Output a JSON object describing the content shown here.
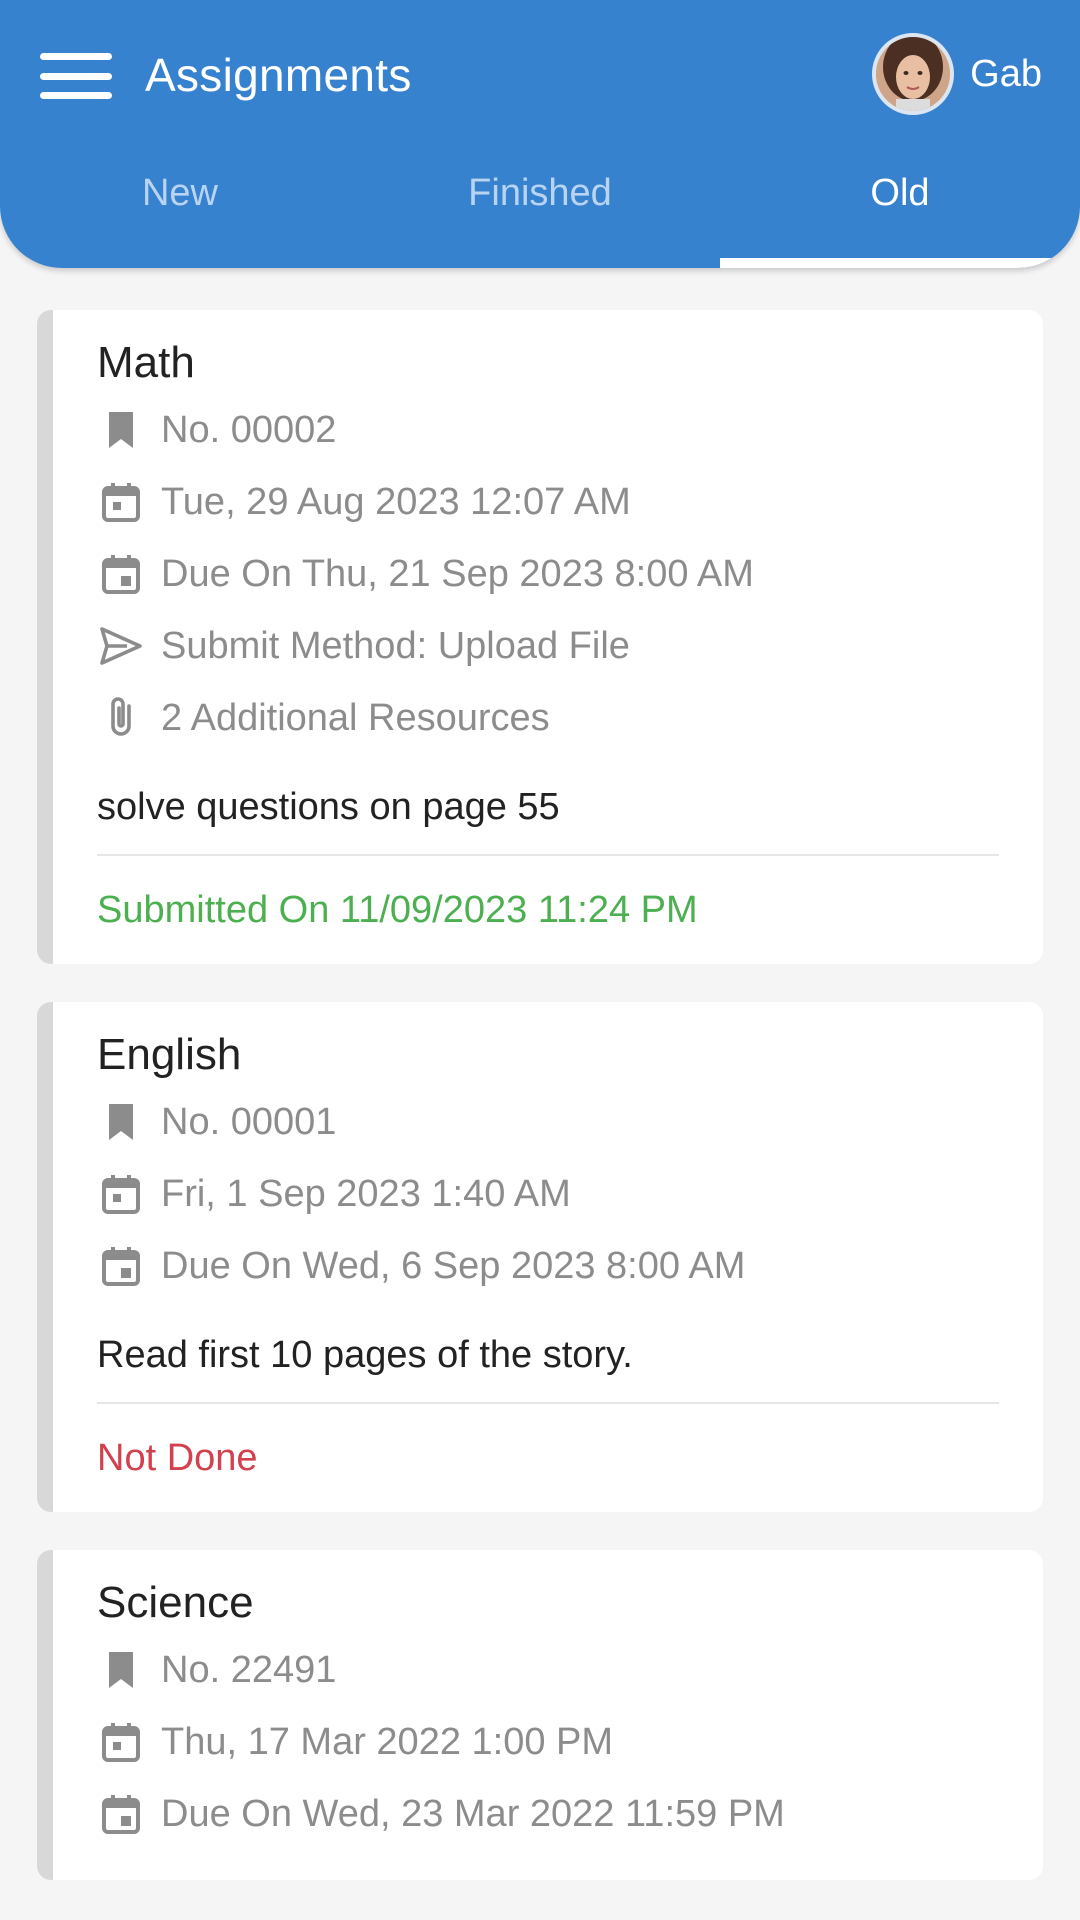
{
  "header": {
    "title": "Assignments",
    "user_name": "Gab"
  },
  "tabs": [
    {
      "label": "New"
    },
    {
      "label": "Finished"
    },
    {
      "label": "Old"
    }
  ],
  "active_tab": "Old",
  "assignments": [
    {
      "subject": "Math",
      "number": "No. 00002",
      "created": "Tue, 29 Aug 2023 12:07 AM",
      "due": "Due On Thu, 21 Sep 2023 8:00 AM",
      "submit_method": "Submit Method: Upload File",
      "resources": "2 Additional Resources",
      "description": "solve questions on page 55",
      "status": "Submitted On 11/09/2023 11:24 PM",
      "status_color": "#4caf50"
    },
    {
      "subject": "English",
      "number": "No. 00001",
      "created": "Fri, 1 Sep 2023 1:40 AM",
      "due": "Due On Wed, 6 Sep 2023 8:00 AM",
      "description": "Read first 10 pages of the story.",
      "status": "Not Done",
      "status_color": "#d3404e"
    },
    {
      "subject": "Science",
      "number": "No. 22491",
      "created": "Thu, 17 Mar 2022 1:00 PM",
      "due": "Due On Wed, 23 Mar 2022 11:59 PM"
    }
  ],
  "colors": {
    "primary": "#3782cf",
    "card_accent": "#d8d8d8"
  },
  "icons": {
    "menu": "hamburger-menu-icon",
    "number": "bookmark-icon",
    "created": "calendar-icon",
    "due": "calendar-event-icon",
    "submit": "send-icon",
    "resources": "paperclip-icon"
  }
}
